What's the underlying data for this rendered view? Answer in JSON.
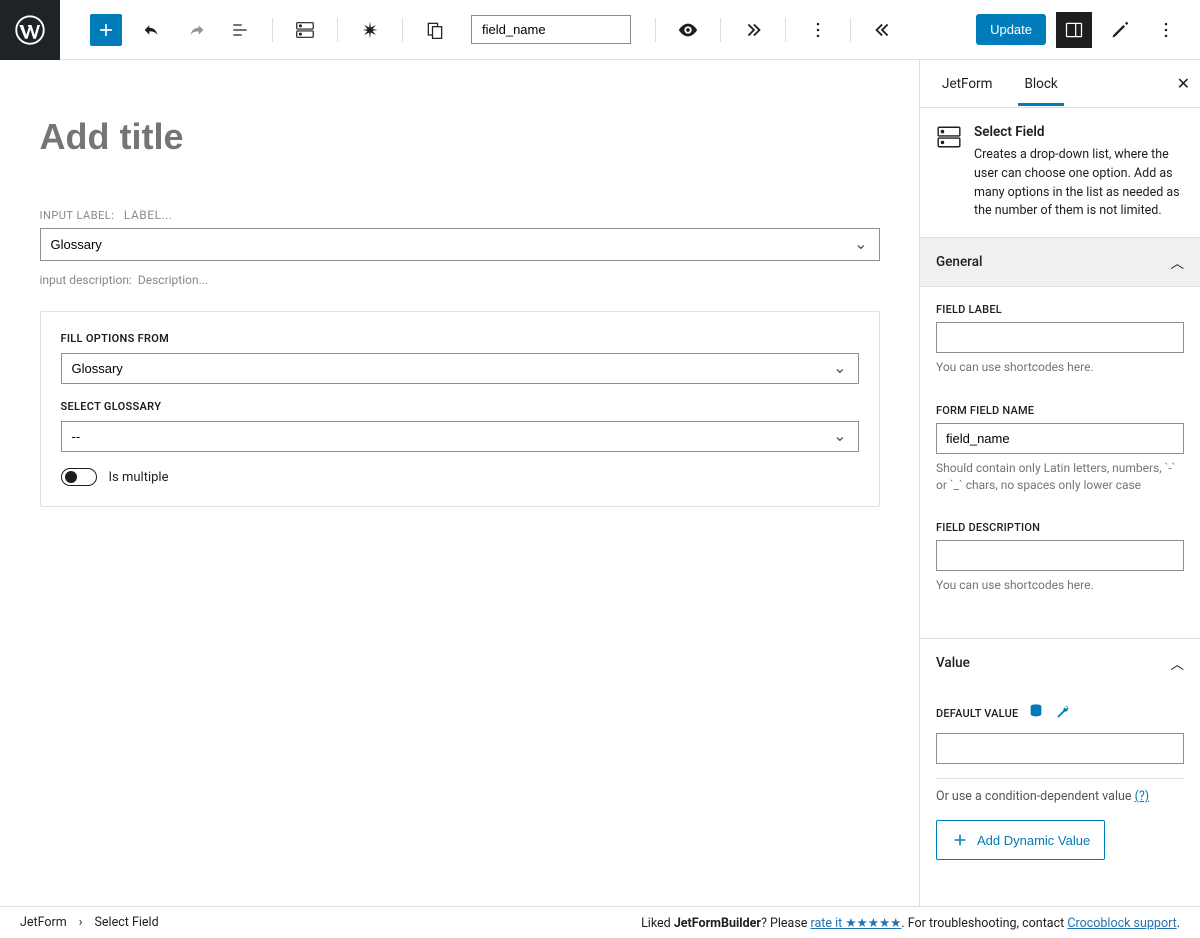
{
  "toolbar": {
    "field_name": "field_name",
    "update": "Update"
  },
  "editor": {
    "title_placeholder": "Add title",
    "input_label_caption": "INPUT LABEL:",
    "label_placeholder": " LABEL...",
    "main_select_value": "Glossary",
    "desc_caption": "input description:",
    "desc_placeholder": "Description...",
    "card": {
      "fill_from_label": "FILL OPTIONS FROM",
      "fill_from_value": "Glossary",
      "select_glossary_label": "SELECT GLOSSARY",
      "glossary_value": "--",
      "is_multiple": "Is multiple"
    }
  },
  "sidebar": {
    "tabs": {
      "jetform": "JetForm",
      "block": "Block"
    },
    "block": {
      "name": "Select Field",
      "help": "Creates a drop-down list, where the user can choose one option. Add as many options in the list as needed as the number of them is not limited."
    },
    "general": {
      "title": "General",
      "field_label": "FIELD LABEL",
      "field_label_help": "You can use shortcodes here.",
      "form_field_name": "FORM FIELD NAME",
      "form_field_name_value": "field_name",
      "form_field_name_help": "Should contain only Latin letters, numbers, `-` or `_` chars, no spaces only lower case",
      "field_description": "FIELD DESCRIPTION",
      "field_description_help": "You can use shortcodes here."
    },
    "value": {
      "title": "Value",
      "default_value": "DEFAULT VALUE",
      "cond_text_prefix": "Or use a condition-dependent value ",
      "cond_link": "(?)",
      "add_dynamic": "Add Dynamic Value"
    }
  },
  "footer": {
    "crumb1": "JetForm",
    "crumb2": "Select Field",
    "msg_prefix": "Liked ",
    "msg_bold": "JetFormBuilder",
    "msg_q": "? Please ",
    "rate_link": "rate it ★★★★★",
    "msg_mid": ". For troubleshooting, contact ",
    "support_link": "Crocoblock support",
    "msg_end": "."
  }
}
